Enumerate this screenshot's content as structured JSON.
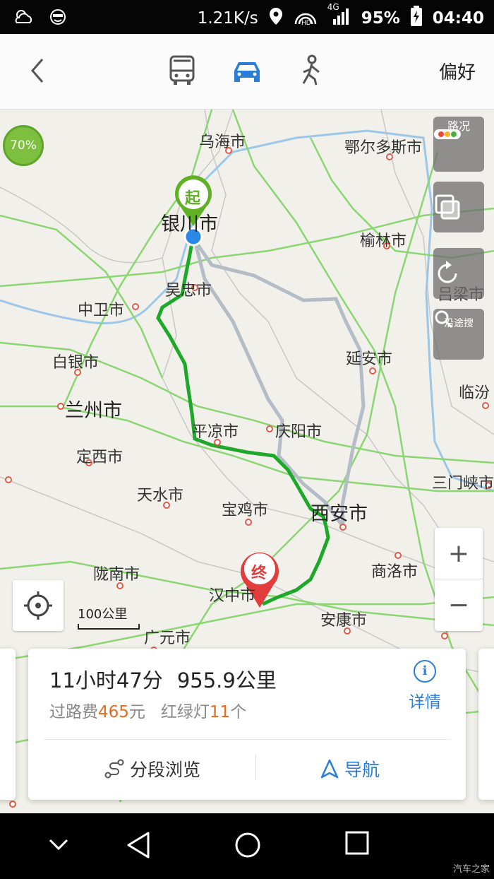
{
  "status_bar": {
    "speed": "1.21K/s",
    "network": "4G",
    "battery": "95%",
    "time": "04:40"
  },
  "top_nav": {
    "modes": [
      "bus-icon",
      "car-icon",
      "walk-icon"
    ],
    "active_mode": "car",
    "preferences": "偏好",
    "accent_color": "#2a7ed8"
  },
  "map": {
    "traffic_percent": "70%",
    "cities": {
      "wuhai": "乌海市",
      "ordos": "鄂尔多斯市",
      "yinchuan": "银川市",
      "yulin": "榆林市",
      "wuzhong": "吴忠市",
      "lvliang": "吕梁市",
      "zhongwei": "中卫市",
      "baiyin": "白银市",
      "yanan": "延安市",
      "lanzhou": "兰州市",
      "linfen": "临汾",
      "pingliang": "平凉市",
      "qingyang": "庆阳市",
      "dingxi": "定西市",
      "sanmenxia": "三门峡市",
      "tianshui": "天水市",
      "baoji": "宝鸡市",
      "xian": "西安市",
      "longnan": "陇南市",
      "shangluo": "商洛市",
      "hanzhong": "汉中市",
      "ankang": "安康市",
      "guangyuan": "广元市"
    },
    "start_marker": "起",
    "end_marker": "终",
    "controls": {
      "traffic": "路况",
      "along_search": "沿途搜"
    },
    "scale": "100公里",
    "zoom_in": "+",
    "zoom_out": "−",
    "route_color": "#1ea82a"
  },
  "route_card": {
    "duration": "11小时47分",
    "distance": "955.9公里",
    "toll_label": "过路费",
    "toll_value": "465",
    "toll_unit": "元",
    "lights_label": "红绿灯",
    "lights_value": "11",
    "lights_unit": "个",
    "details": "详情",
    "segments": "分段浏览",
    "navigate": "导航"
  },
  "watermark": "汽车之家"
}
